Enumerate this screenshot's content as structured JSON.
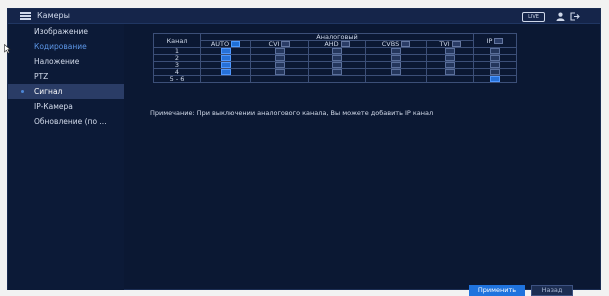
{
  "app": {
    "title": "Камеры",
    "live_label": "LIVE"
  },
  "sidebar": {
    "items": [
      {
        "label": "Изображение",
        "state": "normal"
      },
      {
        "label": "Кодирование",
        "state": "highlight"
      },
      {
        "label": "Наложение",
        "state": "normal"
      },
      {
        "label": "PTZ",
        "state": "normal"
      },
      {
        "label": "Сигнал",
        "state": "active"
      },
      {
        "label": "IP-Камера",
        "state": "normal"
      },
      {
        "label": "Обновление (по ...",
        "state": "normal"
      }
    ]
  },
  "grid": {
    "channel_header": "Канал",
    "analog_header": "Аналоговый",
    "ip_header": "IP",
    "columns": [
      "AUTO",
      "CVI",
      "AHD",
      "CVBS",
      "TVI"
    ],
    "header_checks": {
      "AUTO": true,
      "CVI": false,
      "AHD": false,
      "CVBS": false,
      "TVI": false,
      "IP": false
    },
    "rows": [
      {
        "channel": "1",
        "auto": true,
        "cvi": false,
        "ahd": false,
        "cvbs": false,
        "tvi": false,
        "ip": false
      },
      {
        "channel": "2",
        "auto": true,
        "cvi": false,
        "ahd": false,
        "cvbs": false,
        "tvi": false,
        "ip": false
      },
      {
        "channel": "3",
        "auto": true,
        "cvi": false,
        "ahd": false,
        "cvbs": false,
        "tvi": false,
        "ip": false
      },
      {
        "channel": "4",
        "auto": true,
        "cvi": false,
        "ahd": false,
        "cvbs": false,
        "tvi": false,
        "ip": false
      },
      {
        "channel": "5 - 6",
        "auto": null,
        "cvi": null,
        "ahd": null,
        "cvbs": null,
        "tvi": null,
        "ip": true
      }
    ]
  },
  "note": "Примечание: При выключении аналогового канала, Вы можете добавить IP канал",
  "buttons": {
    "apply": "Применить",
    "back": "Назад"
  },
  "icons": {
    "menu": "menu-icon",
    "user": "user-icon",
    "logout": "logout-icon",
    "cursor": "cursor-icon",
    "bullet": "bullet-icon"
  },
  "colors": {
    "background": "#0b1833",
    "topbar": "#15254a",
    "active_item": "#2a3c66",
    "highlight_text": "#5d97e8",
    "accent": "#1f73de"
  }
}
